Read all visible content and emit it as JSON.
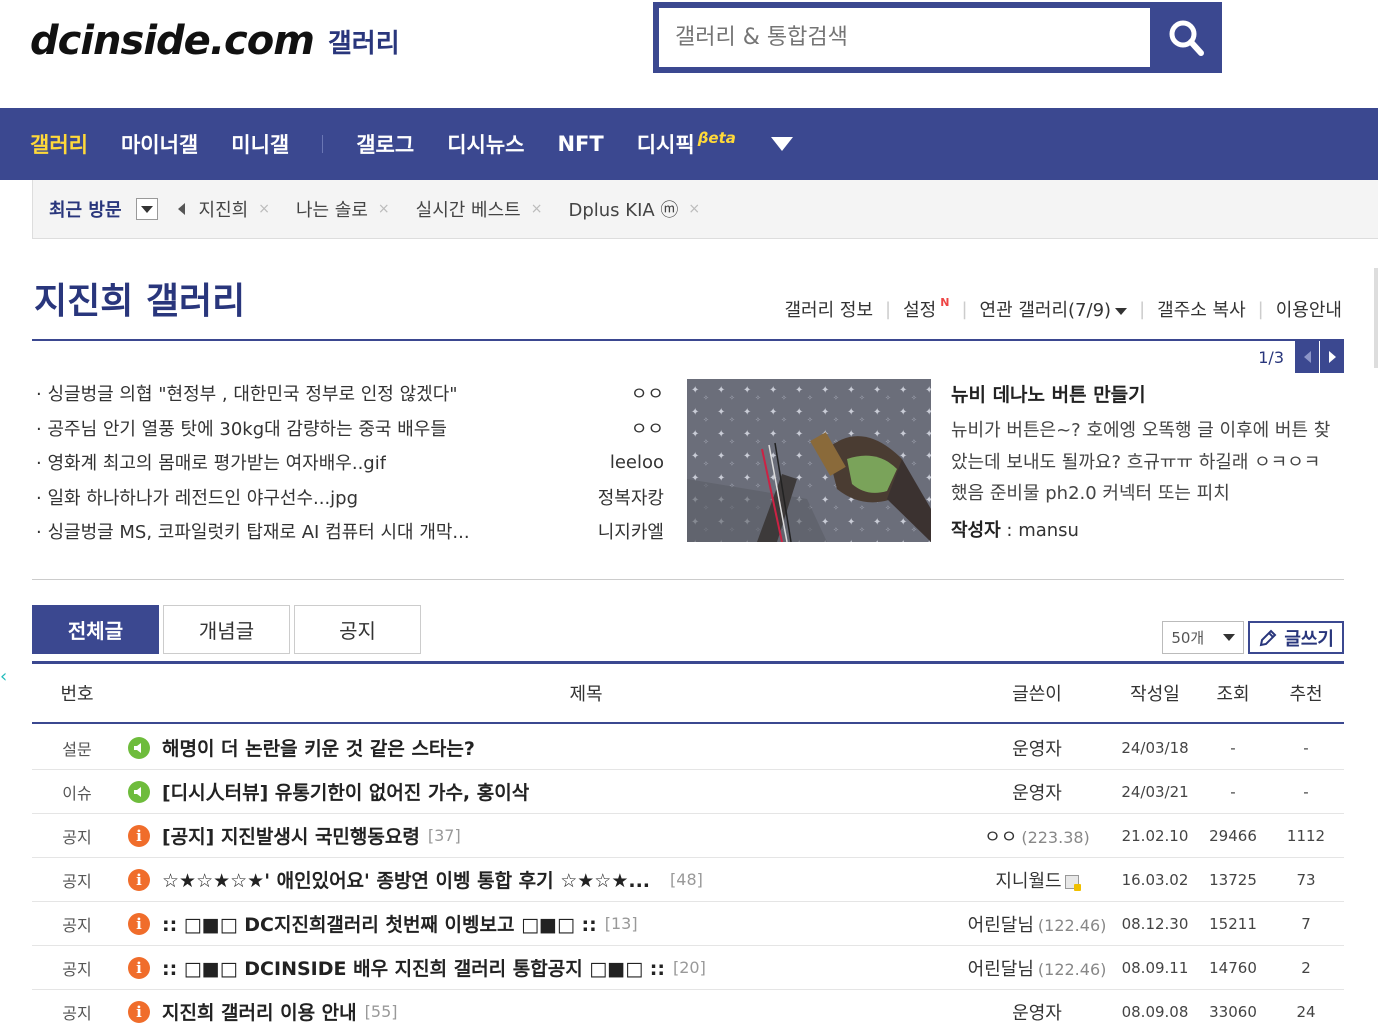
{
  "header": {
    "logo": "dcinside.com",
    "logo_sub": "갤러리",
    "search_placeholder": "갤러리 & 통합검색"
  },
  "nav": {
    "items": [
      "갤러리",
      "마이너갤",
      "미니갤",
      "갤로그",
      "디시뉴스",
      "NFT",
      "디시픽"
    ],
    "beta": "βeta"
  },
  "recent": {
    "label": "최근 방문",
    "items": [
      "지진희",
      "나는 솔로",
      "실시간 베스트",
      "Dplus KIA ⓜ"
    ],
    "close": "×"
  },
  "gallery": {
    "title": "지진희 갤러리",
    "links": [
      "갤러리 정보",
      "설정",
      "연관 갤러리(7/9)",
      "갤주소 복사",
      "이용안내"
    ],
    "new_badge": "N"
  },
  "featured": {
    "pager": "1/3",
    "hot": [
      {
        "title": "· 싱글벙글 의협 \"현정부 , 대한민국 정부로 인정 않겠다\"",
        "author": "ㅇㅇ"
      },
      {
        "title": "· 공주님 안기 열풍 탓에 30kg대 감량하는 중국 배우들",
        "author": "ㅇㅇ"
      },
      {
        "title": "· 영화계 최고의 몸매로 평가받는 여자배우..gif",
        "author": "leeloo"
      },
      {
        "title": "· 일화 하나하나가 레전드인 야구선수...jpg",
        "author": "정복자캉"
      },
      {
        "title": "· 싱글벙글 MS, 코파일럿키 탑재로 AI 컴퓨터 시대 개막...",
        "author": "니지카엘"
      }
    ],
    "title": "뉴비 데나노 버튼 만들기",
    "body": "뉴비가 버튼은~? 호에엥 오똑행 글 이후에 버튼 찾았는데 보내도 될까요? 흐규ㅠㅠ 하길래 ㅇㅋㅇㅋ했음 준비물 ph2.0 커넥터 또는 피치",
    "author_label": "작성자",
    "author": " : mansu"
  },
  "tabs": [
    "전체글",
    "개념글",
    "공지"
  ],
  "list_tools": {
    "count": "50개",
    "write": "글쓰기"
  },
  "table": {
    "headers": [
      "번호",
      "제목",
      "글쓴이",
      "작성일",
      "조회",
      "추천"
    ],
    "rows": [
      {
        "num": "설문",
        "icon": "survey",
        "title": "해명이 더 논란을 키운 것 같은 스타는?",
        "reply": "",
        "writer": "운영자",
        "ip": "",
        "date": "24/03/18",
        "views": "-",
        "rec": "-"
      },
      {
        "num": "이슈",
        "icon": "survey",
        "title": "[디시人터뷰] 유통기한이 없어진 가수, 홍이삭",
        "reply": "",
        "writer": "운영자",
        "ip": "",
        "date": "24/03/21",
        "views": "-",
        "rec": "-"
      },
      {
        "num": "공지",
        "icon": "notice",
        "title": "[공지] 지진발생시 국민행동요령",
        "reply": "[37]",
        "writer": "ㅇㅇ",
        "ip": "(223.38)",
        "date": "21.02.10",
        "views": "29466",
        "rec": "1112"
      },
      {
        "num": "공지",
        "icon": "notice",
        "title": "☆★☆★☆★' 애인있어요' 종방연 이벵 통합 후기 ☆★☆★...",
        "reply": "[48]",
        "writer": "지니월드",
        "ip": "",
        "date": "16.03.02",
        "views": "13725",
        "rec": "73"
      },
      {
        "num": "공지",
        "icon": "notice",
        "title": ":: □■□ DC지진희갤러리 첫번째 이벵보고 □■□ ::",
        "reply": "[13]",
        "writer": "어린달님",
        "ip": "(122.46)",
        "date": "08.12.30",
        "views": "15211",
        "rec": "7"
      },
      {
        "num": "공지",
        "icon": "notice",
        "title": ":: □■□ DCINSIDE 배우 지진희 갤러리 통합공지 □■□ ::",
        "reply": "[20]",
        "writer": "어린달님",
        "ip": "(122.46)",
        "date": "08.09.11",
        "views": "14760",
        "rec": "2"
      },
      {
        "num": "공지",
        "icon": "notice",
        "title": "지진희 갤러리 이용 안내",
        "reply": "[55]",
        "writer": "운영자",
        "ip": "",
        "date": "08.09.08",
        "views": "33060",
        "rec": "24"
      }
    ]
  },
  "side_mark": "‹"
}
